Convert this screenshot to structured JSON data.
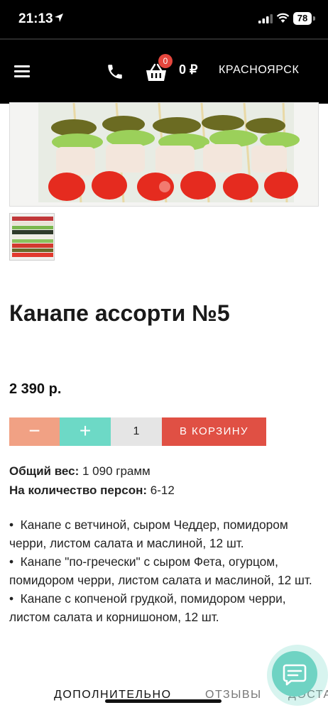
{
  "status_bar": {
    "time": "21:13",
    "battery": "78"
  },
  "header": {
    "cart_count": "0",
    "cart_total": "0 ₽",
    "city": "КРАСНОЯРСК"
  },
  "product": {
    "title": "Канапе ассорти №5",
    "price": "2 390 р.",
    "quantity": "1",
    "add_to_cart": "В КОРЗИНУ",
    "specs": {
      "weight_label": "Общий вес:",
      "weight_value": "1 090 грамм",
      "persons_label": "На количество персон:",
      "persons_value": "6-12"
    },
    "description": [
      "Канапе с ветчиной, сыром Чеддер, помидором черри, листом салата и маслиной, 12 шт.",
      "Канапе \"по-гречески\" с сыром Фета, огурцом, помидором черри, листом салата и маслиной, 12 шт.",
      "Канапе с копченой грудкой, помидором черри, листом салата и корнишоном, 12 шт."
    ]
  },
  "tabs": [
    "ДОПОЛНИТЕЛЬНО",
    "ОТЗЫВЫ",
    "ДОСТАВКА"
  ],
  "icons": {
    "menu": "hamburger-icon",
    "phone": "phone-icon",
    "cart": "basket-icon",
    "chat": "chat-icon"
  },
  "colors": {
    "minus": "#f1a184",
    "plus": "#6dd9c6",
    "cart_button": "#e05044",
    "badge": "#e5463d",
    "chat": "#6fd3c3"
  }
}
